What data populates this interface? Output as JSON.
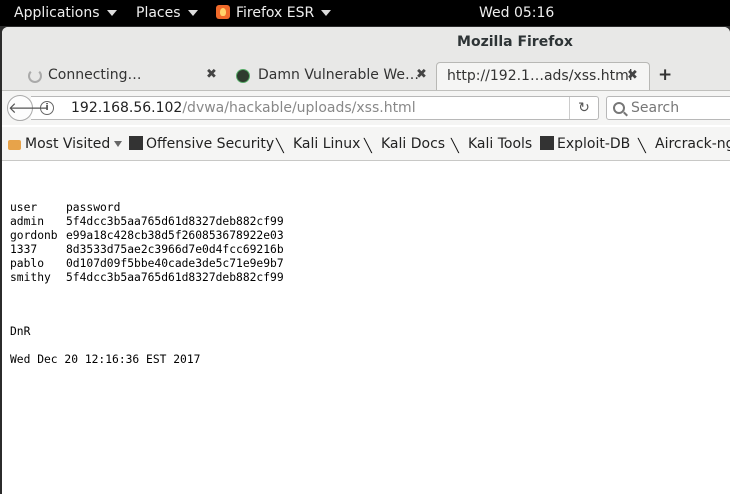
{
  "topbar": {
    "applications": "Applications",
    "places": "Places",
    "app": "Firefox ESR",
    "clock": "Wed 05:16"
  },
  "window": {
    "title": "Mozilla Firefox"
  },
  "tabs": [
    {
      "label": "Connecting…",
      "close": "✖"
    },
    {
      "label": "Damn Vulnerable We…",
      "close": "✖"
    },
    {
      "label": "http://192.1…ads/xss.html",
      "close": "✖"
    }
  ],
  "newtab": "+",
  "nav": {
    "url_host": "192.168.56.102",
    "url_path": "/dvwa/hackable/uploads/xss.html",
    "search_placeholder": "Search"
  },
  "bookmarks": [
    {
      "label": "Most Visited",
      "icon": "folder-icon"
    },
    {
      "label": "Offensive Security",
      "icon": "offsec-icon"
    },
    {
      "label": "Kali Linux",
      "icon": "kali-dragon-icon"
    },
    {
      "label": "Kali Docs",
      "icon": "kali-dragon-icon"
    },
    {
      "label": "Kali Tools",
      "icon": "kali-dragon-icon"
    },
    {
      "label": "Exploit-DB",
      "icon": "exploitdb-icon"
    },
    {
      "label": "Aircrack-ng",
      "icon": "aircrack-icon"
    }
  ],
  "content": {
    "header": {
      "user": "user",
      "password": "password"
    },
    "rows": [
      {
        "user": "admin",
        "hash": "5f4dcc3b5aa765d61d8327deb882cf99"
      },
      {
        "user": "gordonb",
        "hash": "e99a18c428cb38d5f260853678922e03"
      },
      {
        "user": "1337",
        "hash": "8d3533d75ae2c3966d7e0d4fcc69216b"
      },
      {
        "user": "pablo",
        "hash": "0d107d09f5bbe40cade3de5c71e9e9b7"
      },
      {
        "user": "smithy",
        "hash": "5f4dcc3b5aa765d61d8327deb882cf99"
      }
    ],
    "footer_name": "DnR",
    "footer_date": "Wed Dec 20 12:16:36 EST 2017"
  }
}
